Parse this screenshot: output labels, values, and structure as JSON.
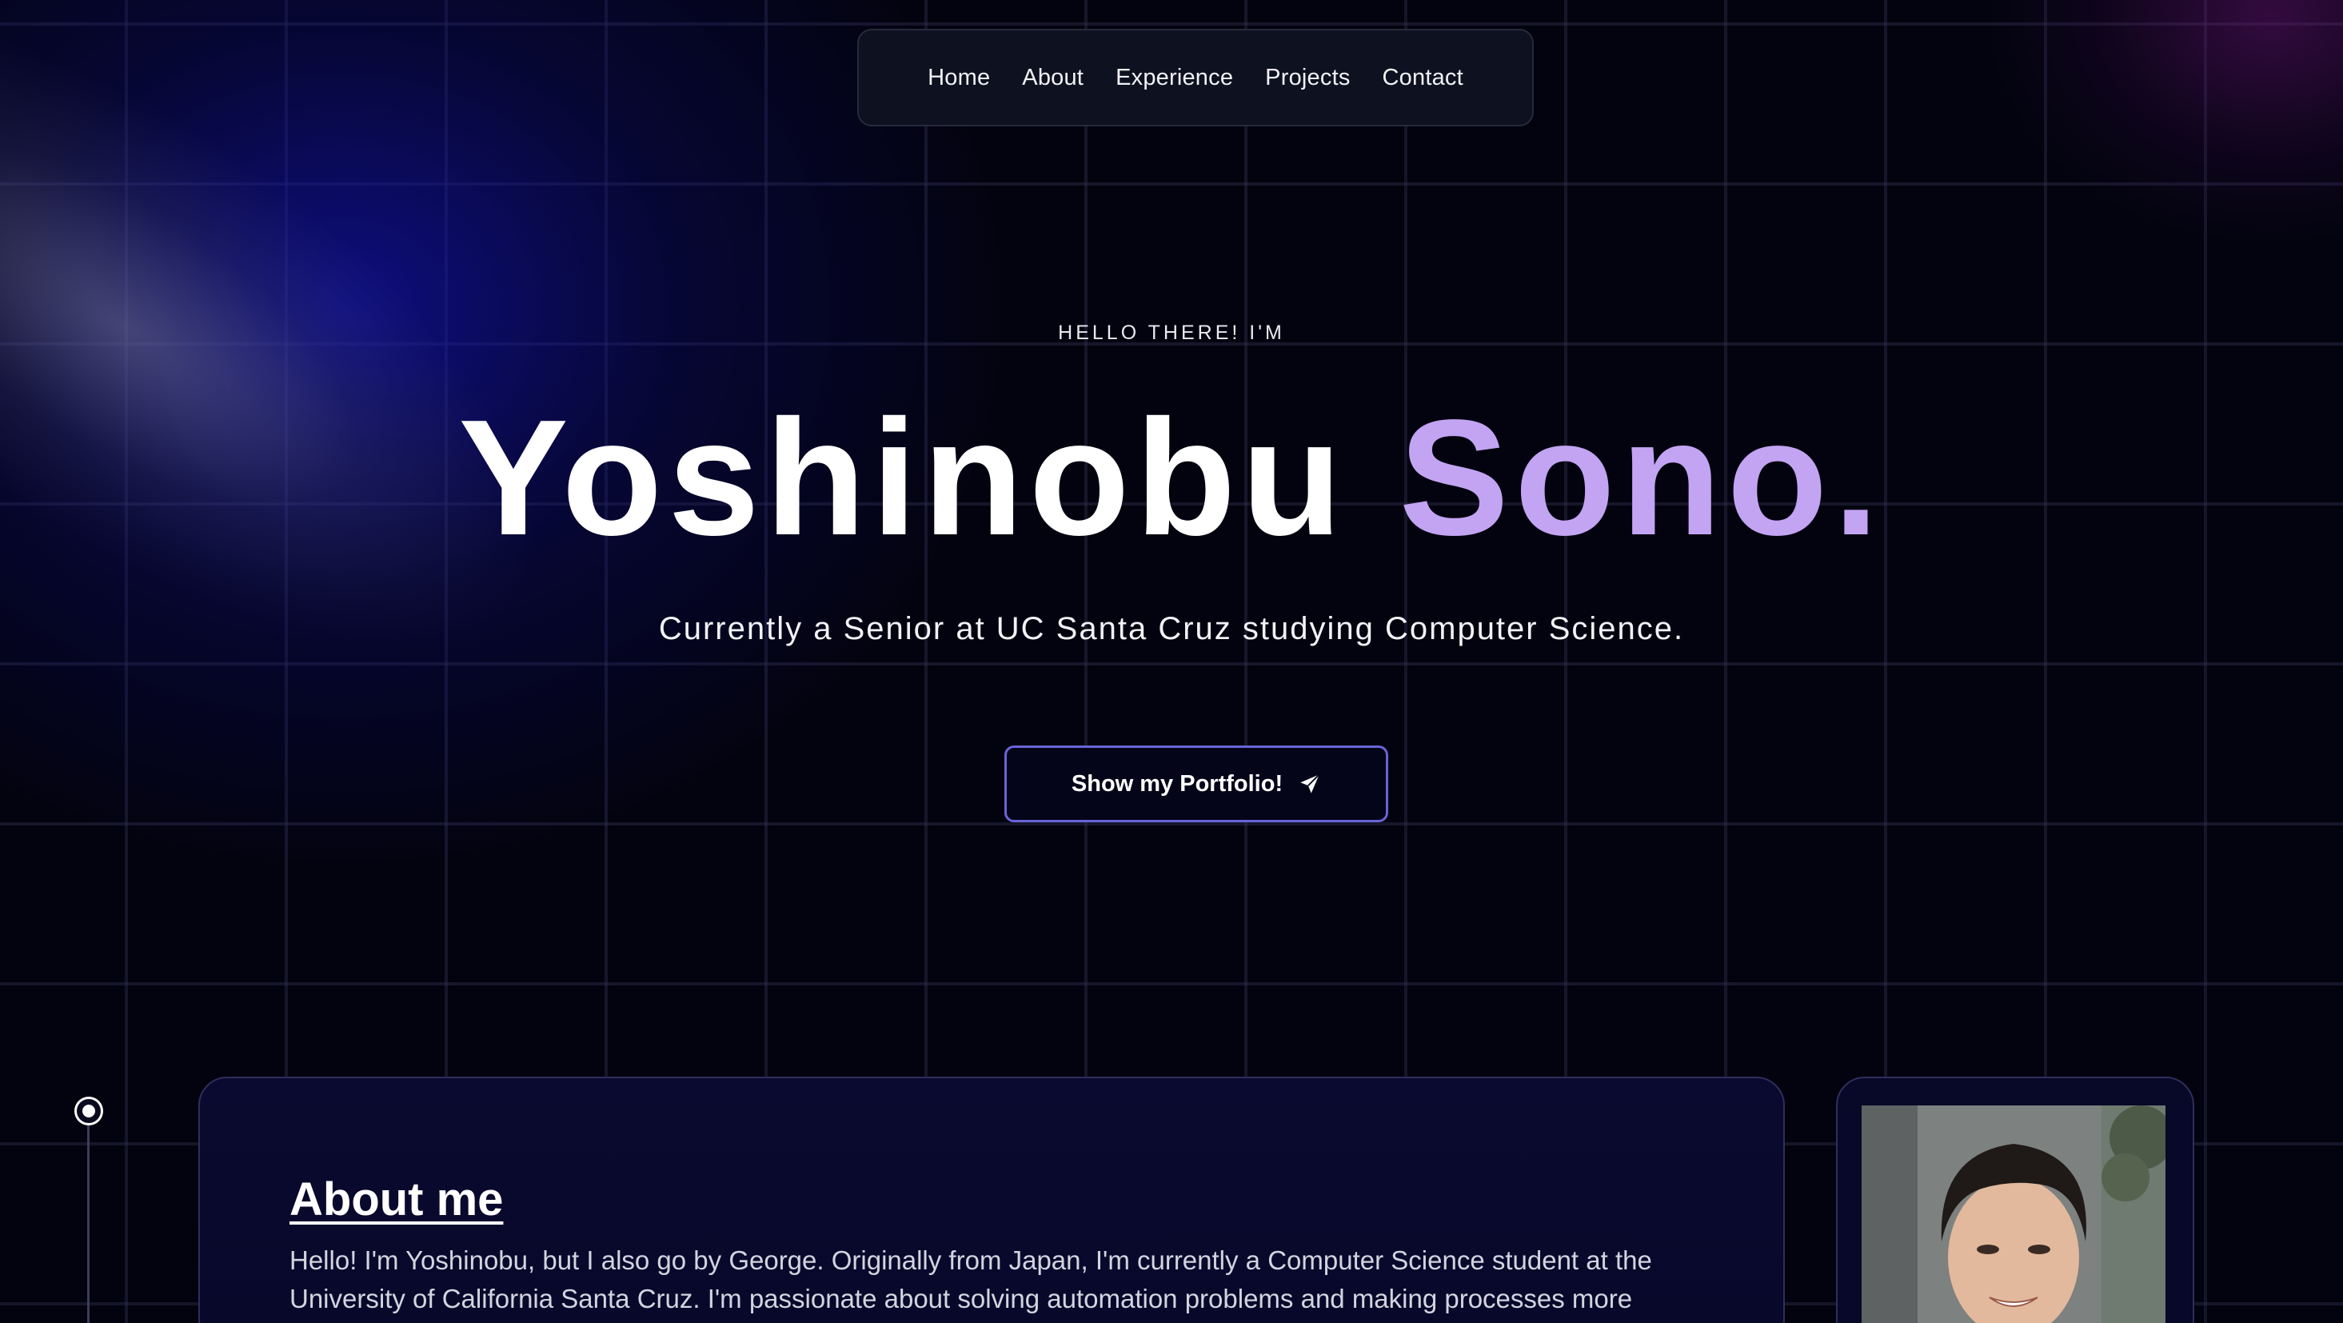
{
  "nav": {
    "items": [
      {
        "label": "Home"
      },
      {
        "label": "About"
      },
      {
        "label": "Experience"
      },
      {
        "label": "Projects"
      },
      {
        "label": "Contact"
      }
    ]
  },
  "hero": {
    "eyebrow": "HELLO THERE! I'M",
    "first_name": "Yoshinobu",
    "last_name": "Sono.",
    "subtitle": "Currently a Senior at UC Santa Cruz studying Computer Science.",
    "cta_label": "Show my Portfolio!",
    "cta_icon": "send-icon"
  },
  "about": {
    "heading": "About me",
    "text": "Hello! I'm Yoshinobu, but I also go by George. Originally from Japan, I'm currently a Computer Science student at the University of California Santa Cruz. I'm passionate about solving automation problems and making processes more efficient."
  },
  "colors": {
    "background": "#03030f",
    "accent_purple": "#c3a4f3",
    "button_border": "#6a64d8",
    "card_background": "#0a0a30"
  }
}
